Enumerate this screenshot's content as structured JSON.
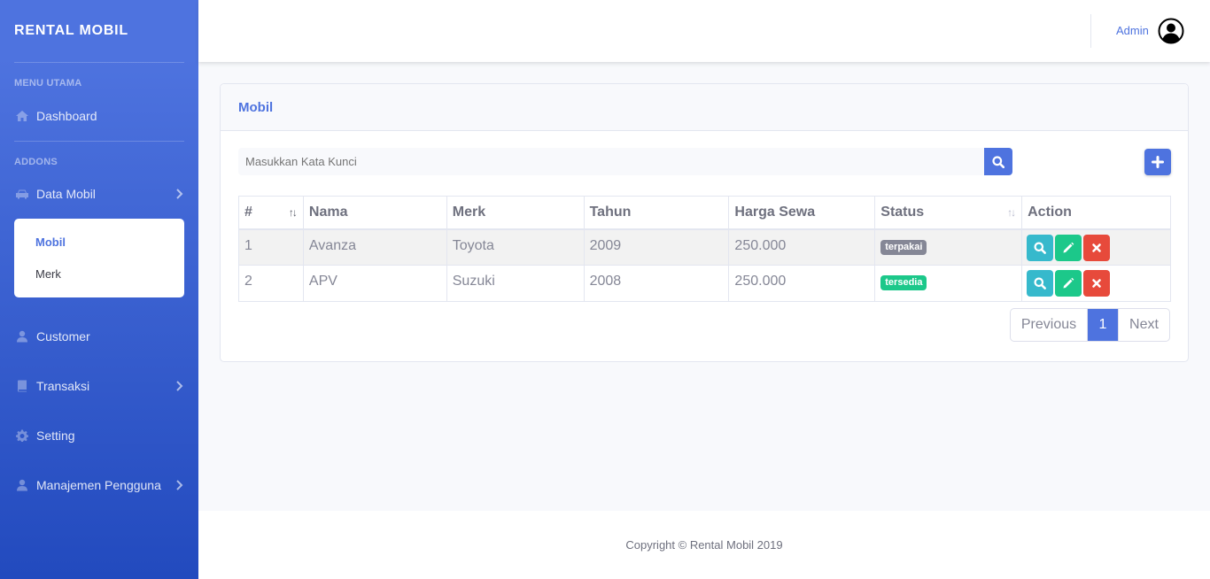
{
  "brand": "RENTAL MOBIL",
  "sidebar": {
    "menu_utama": "MENU UTAMA",
    "dashboard": "Dashboard",
    "addons": "ADDONS",
    "data_mobil": "Data Mobil",
    "sub_items": [
      "Mobil",
      "Merk"
    ],
    "customer": "Customer",
    "transaksi": "Transaksi",
    "setting": "Setting",
    "manajemen": "Manajemen Pengguna"
  },
  "topbar": {
    "username": "Admin"
  },
  "card": {
    "title": "Mobil",
    "search_placeholder": "Masukkan Kata Kunci"
  },
  "table": {
    "headers": [
      "#",
      "Nama",
      "Merk",
      "Tahun",
      "Harga Sewa",
      "Status",
      "Action"
    ],
    "rows": [
      {
        "no": "1",
        "nama": "Avanza",
        "merk": "Toyota",
        "tahun": "2009",
        "harga": "250.000",
        "status": "terpakai"
      },
      {
        "no": "2",
        "nama": "APV",
        "merk": "Suzuki",
        "tahun": "2008",
        "harga": "250.000",
        "status": "tersedia"
      }
    ]
  },
  "pagination": {
    "previous": "Previous",
    "page": "1",
    "next": "Next"
  },
  "footer": {
    "copyright": "Copyright © Rental Mobil 2019"
  },
  "colors": {
    "primary": "#4e73df",
    "success": "#1cc88a",
    "info": "#36b9cc",
    "danger": "#e74a3b",
    "secondary": "#858796"
  }
}
